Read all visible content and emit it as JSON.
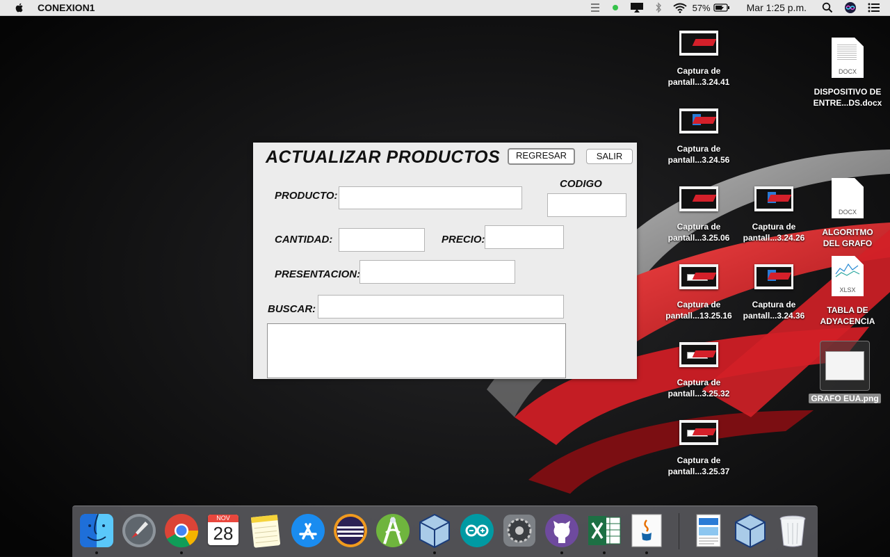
{
  "menubar": {
    "app_name": "CONEXION1",
    "battery_pct": "57%",
    "clock": "Mar 1:25 p.m."
  },
  "window": {
    "title": "ACTUALIZAR PRODUCTOS",
    "buttons": {
      "back": "REGRESAR",
      "exit": "SALIR"
    },
    "labels": {
      "producto": "PRODUCTO:",
      "codigo": "CODIGO",
      "cantidad": "CANTIDAD:",
      "precio": "PRECIO:",
      "presentacion": "PRESENTACION:",
      "buscar": "BUSCAR:"
    },
    "fields": {
      "producto": "",
      "codigo": "",
      "cantidad": "",
      "precio": "",
      "presentacion": "",
      "buscar": ""
    }
  },
  "desktop": {
    "screenshots": [
      {
        "line1": "Captura de",
        "line2": "pantall...3.24.41",
        "style": "dark"
      },
      {
        "line1": "Captura de",
        "line2": "pantall...3.24.56",
        "style": "blue"
      },
      {
        "line1": "Captura de",
        "line2": "pantall...3.25.06",
        "style": "dark"
      },
      {
        "line1": "Captura de",
        "line2": "pantall...13.25.16",
        "style": "light"
      },
      {
        "line1": "Captura de",
        "line2": "pantall...3.25.32",
        "style": "light"
      },
      {
        "line1": "Captura de",
        "line2": "pantall...3.25.37",
        "style": "light"
      },
      {
        "line1": "Captura de",
        "line2": "pantall...3.24.26",
        "style": "blue"
      },
      {
        "line1": "Captura de",
        "line2": "pantall...3.24.36",
        "style": "blue"
      }
    ],
    "documents": [
      {
        "line1": "DISPOSITIVO DE",
        "line2": "ENTRE...DS.docx",
        "ext": "DOCX"
      },
      {
        "line1": "ALGORITMO",
        "line2": "DEL GRAFO",
        "ext": "DOCX"
      },
      {
        "line1": "TABLA DE",
        "line2": "ADYACENCIA",
        "ext": "XLSX"
      }
    ],
    "image_file": "GRAFO EUA.png"
  },
  "dock": {
    "calendar_month": "NOV",
    "calendar_day": "28",
    "apps": [
      "finder",
      "launchpad",
      "chrome",
      "calendar",
      "notes",
      "app-store",
      "eclipse",
      "android-studio",
      "virtualbox",
      "arduino",
      "system-preferences",
      "github-desktop",
      "excel",
      "java",
      "preview-doc",
      "virtualbox-vm",
      "trash"
    ]
  }
}
